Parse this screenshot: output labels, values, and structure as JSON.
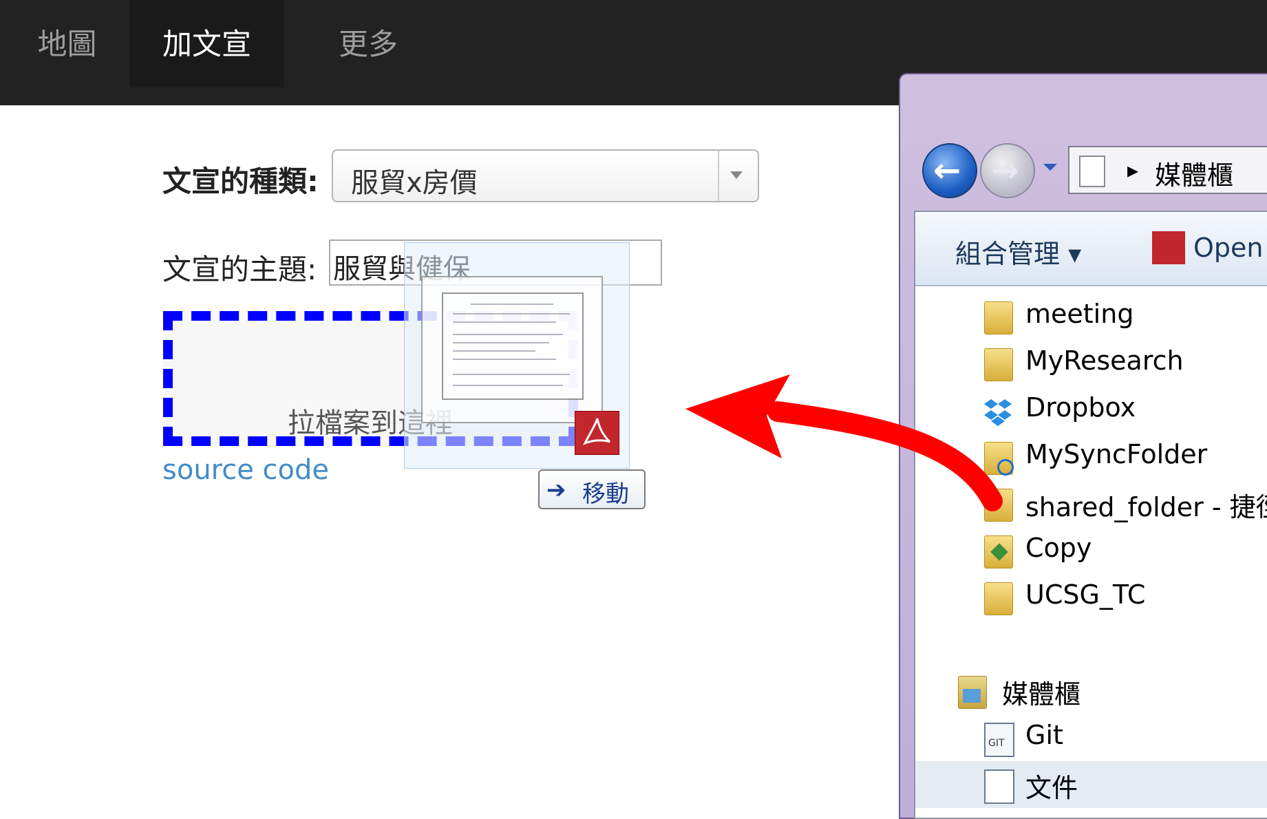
{
  "nav": {
    "items": [
      "地圖",
      "加文宣",
      "更多"
    ],
    "active_index": 1
  },
  "form": {
    "type_label": "文宣的種類:",
    "type_value": "服貿x房價",
    "topic_label": "文宣的主題:",
    "topic_value": "服貿與健保",
    "dropzone_label": "拉檔案到這裡",
    "source_link": "source code"
  },
  "drag_ghost": {
    "move_label": "移動",
    "file_type_icon": "pdf-icon"
  },
  "explorer": {
    "breadcrumb_sep": "▸",
    "breadcrumb_location": "媒體櫃",
    "commands": {
      "organize": "組合管理 ▾",
      "open_with": "Open"
    },
    "tree": [
      {
        "name": "meeting",
        "icon": "folder-icon"
      },
      {
        "name": "MyResearch",
        "icon": "folder-icon"
      },
      {
        "name": "Dropbox",
        "icon": "dropbox-icon"
      },
      {
        "name": "MySyncFolder",
        "icon": "sync-folder-icon"
      },
      {
        "name": "shared_folder - 捷徑",
        "icon": "folder-shortcut-icon"
      },
      {
        "name": "Copy",
        "icon": "copy-icon"
      },
      {
        "name": "UCSG_TC",
        "icon": "folder-icon"
      },
      {
        "name": "媒體櫃",
        "icon": "library-icon"
      },
      {
        "name": "Git",
        "icon": "git-icon"
      },
      {
        "name": "文件",
        "icon": "documents-icon"
      }
    ]
  },
  "colors": {
    "dropzone_border": "#0000ff",
    "link": "#428bca",
    "arrow": "#ff0000",
    "navbar": "#222222"
  }
}
